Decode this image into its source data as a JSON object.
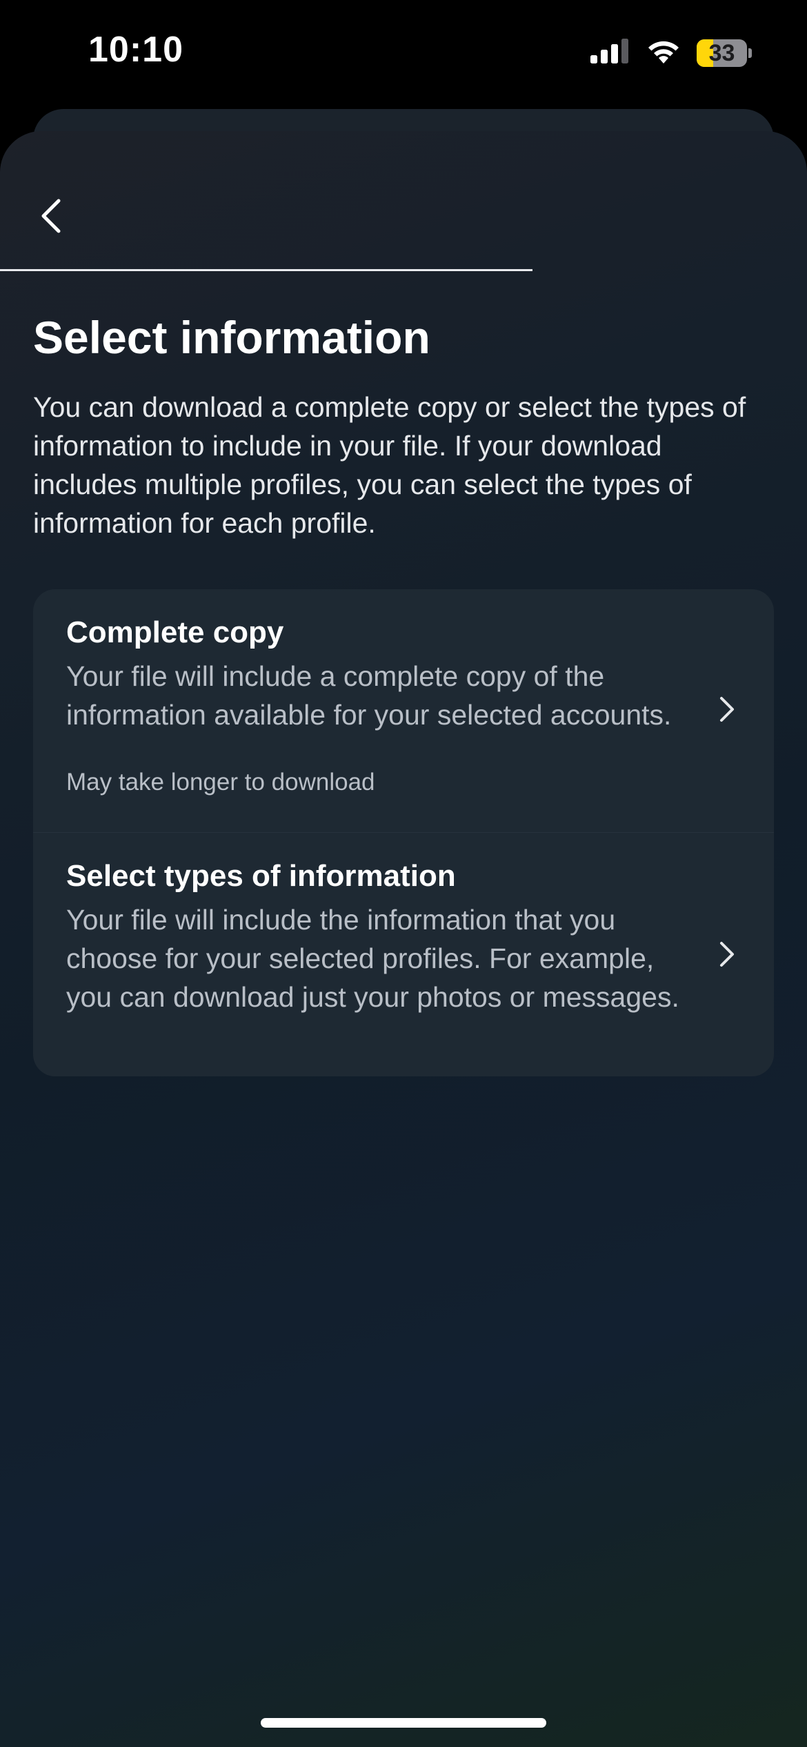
{
  "status_bar": {
    "time": "10:10",
    "battery_level": "33",
    "battery_fraction": 0.33,
    "signal_icon": "cellular-signal-icon",
    "wifi_icon": "wifi-icon"
  },
  "nav": {
    "back_icon": "chevron-left-icon",
    "progress_fraction": 0.66
  },
  "page": {
    "title": "Select information",
    "description": "You can download a complete copy or select the types of information to include in your file. If your download includes multiple profiles, you can select the types of information for each profile."
  },
  "options": [
    {
      "title": "Complete copy",
      "description": "Your file will include a complete copy of the information available for your selected accounts.",
      "note": "May take longer to download",
      "icon": "chevron-right-icon"
    },
    {
      "title": "Select types of information",
      "description": "Your file will include the information that you choose for your selected profiles. For example, you can download just your photos or messages.",
      "icon": "chevron-right-icon"
    }
  ],
  "colors": {
    "background": "#000000",
    "sheet": "#151f2a",
    "card": "#1e2933",
    "battery_accent": "#ffd60a",
    "primary_text": "#ffffff",
    "secondary_text": "#b9bfc7"
  }
}
